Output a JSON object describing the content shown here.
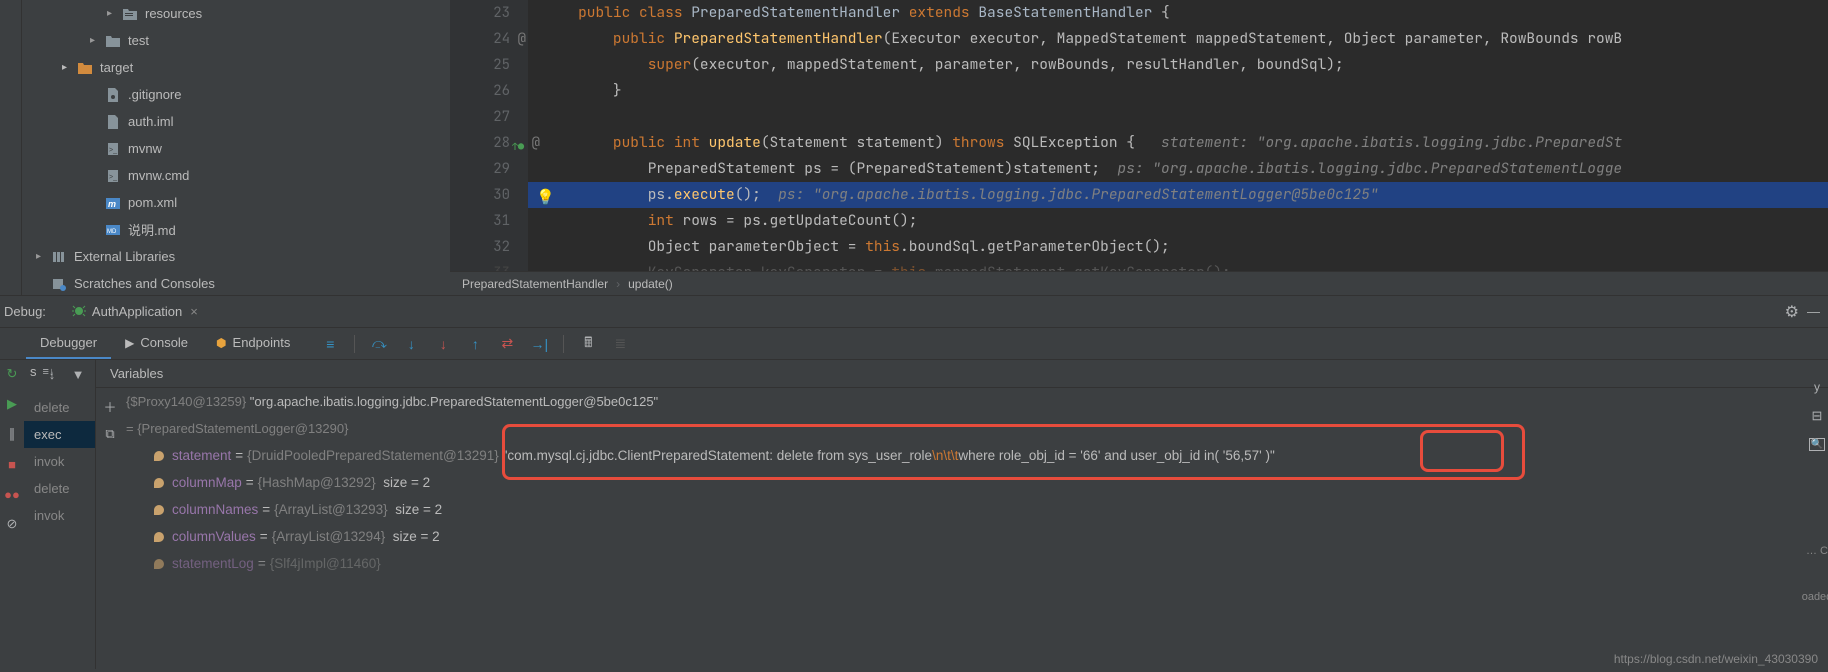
{
  "project_tree": {
    "items": [
      {
        "indent": 3,
        "arrow": "▸",
        "icon": "folder-res",
        "label": "resources"
      },
      {
        "indent": 2,
        "arrow": "▸",
        "icon": "folder",
        "label": "test"
      },
      {
        "indent": 1,
        "arrow": "▸",
        "icon": "folder-orange",
        "label": "target"
      },
      {
        "indent": 2,
        "arrow": "",
        "icon": "gitignore",
        "label": ".gitignore"
      },
      {
        "indent": 2,
        "arrow": "",
        "icon": "iml",
        "label": "auth.iml"
      },
      {
        "indent": 2,
        "arrow": "",
        "icon": "sh",
        "label": "mvnw"
      },
      {
        "indent": 2,
        "arrow": "",
        "icon": "cmd",
        "label": "mvnw.cmd"
      },
      {
        "indent": 2,
        "arrow": "",
        "icon": "maven",
        "label": "pom.xml"
      },
      {
        "indent": 2,
        "arrow": "",
        "icon": "md",
        "label": "说明.md"
      }
    ],
    "external_libraries": "External Libraries",
    "scratches": "Scratches and Consoles"
  },
  "editor": {
    "gutter_start": 23,
    "lines": [
      {
        "n": 23,
        "c": "   <span class='kw'>public</span> <span class='kw'>class</span> <span class='cl'>PreparedStatementHandler</span> <span class='kw'>extends</span> <span class='cl'>BaseStatementHandler</span> {"
      },
      {
        "n": 24,
        "at": "@",
        "c": "       <span class='kw'>public</span> <span class='fn'>PreparedStatementHandler</span>(Executor executor, MappedStatement mappedStatement, Object parameter, RowBounds rowB"
      },
      {
        "n": 25,
        "c": "           <span class='kw'>super</span>(executor, mappedStatement, parameter, rowBounds, resultHandler, boundSql);"
      },
      {
        "n": 26,
        "c": "       }"
      },
      {
        "n": 27,
        "c": ""
      },
      {
        "n": 28,
        "marker": "↑●",
        "at": "@",
        "c": "       <span class='kw'>public</span> <span class='kw'>int</span> <span class='fn'>update</span>(Statement statement) <span class='kw'>throws</span> SQLException {   <span class='cmt'>statement: \"org.apache.ibatis.logging.jdbc.PreparedSt</span>"
      },
      {
        "n": 29,
        "c": "           PreparedStatement ps = (PreparedStatement)statement;  <span class='cmt'>ps: \"org.apache.ibatis.logging.jdbc.PreparedStatementLogge</span>"
      },
      {
        "n": 30,
        "hl": true,
        "c": "           ps.<span class='fn'>execute</span>();  <span class='cmt'>ps: \"org.apache.ibatis.logging.jdbc.PreparedStatementLogger@5be0c125\"</span>"
      },
      {
        "n": 31,
        "c": "           <span class='kw'>int</span> rows = ps.getUpdateCount();"
      },
      {
        "n": 32,
        "c": "           Object parameterObject = <span class='kw'>this</span>.boundSql.getParameterObject();"
      },
      {
        "n": 33,
        "c": "           <span style='color:#555'>KeyGenerator keyGenerator = </span><span class='kw' style='opacity:.5'>this</span><span style='color:#555'>.mappedStatement.getKeyGenerator();</span>"
      }
    ],
    "breadcrumb": [
      "PreparedStatementHandler",
      "update()"
    ]
  },
  "debug": {
    "title": "Debug:",
    "run_config": "AuthApplication",
    "tabs": {
      "debugger": "Debugger",
      "console": "Console",
      "endpoints": "Endpoints"
    },
    "frames_label": "s",
    "variables_label": "Variables",
    "frames": [
      "delete",
      "exec",
      "invok",
      "delete",
      "invok"
    ],
    "vars": {
      "proxy_line": "{$Proxy140@13259} \"org.apache.ibatis.logging.jdbc.PreparedStatementLogger@5be0c125\"",
      "eq_line": "= {PreparedStatementLogger@13290}",
      "statement": {
        "name": "statement",
        "type": "{DruidPooledPreparedStatement@13291}",
        "val_pre": "\"com.mysql.cj.jdbc.ClientPreparedStatement: delete from sys_user_role",
        "val_esc": "\\n\\t\\t",
        "val_mid": "where role_obj_id = '66' and user_obj_id in ",
        "val_paren": "( '56,57' )",
        "val_end": "\""
      },
      "columnMap": {
        "name": "columnMap",
        "type": "{HashMap@13292}",
        "size": "size = 2"
      },
      "columnNames": {
        "name": "columnNames",
        "type": "{ArrayList@13293}",
        "size": "size = 2"
      },
      "columnValues": {
        "name": "columnValues",
        "type": "{ArrayList@13294}",
        "size": "size = 2"
      },
      "statementLog": {
        "name": "statementLog",
        "type": "{Slf4jImpl@11460}"
      }
    }
  },
  "right_labels": {
    "oaded": "oaded",
    "dots": "… C"
  },
  "watermark": "https://blog.csdn.net/weixin_43030390"
}
